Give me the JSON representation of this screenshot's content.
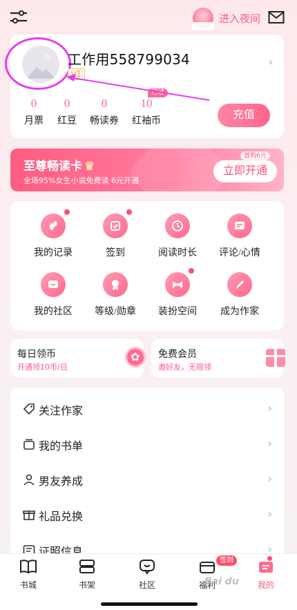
{
  "topbar": {
    "night_mode_label": "进入夜间"
  },
  "profile": {
    "username": "工作用558799034",
    "level": "v1",
    "stats": [
      {
        "value": "0",
        "label": "月票"
      },
      {
        "value": "0",
        "label": "红豆"
      },
      {
        "value": "0",
        "label": "畅读券"
      },
      {
        "value": "10",
        "label": "红袖币"
      }
    ],
    "expire_tag": "已过期",
    "recharge_label": "充值"
  },
  "vip": {
    "title": "至尊畅读卡",
    "subtitle": "全场95%女生小说免费读 6元开通",
    "first_buy_tag": "首购6元",
    "open_label": "立即开通"
  },
  "grid": [
    {
      "label": "我的记录",
      "icon": "footprint-icon",
      "dot": true
    },
    {
      "label": "签到",
      "icon": "checkin-icon",
      "dot": true
    },
    {
      "label": "阅读时长",
      "icon": "clock-icon",
      "dot": false
    },
    {
      "label": "评论/心情",
      "icon": "comment-icon",
      "dot": false
    },
    {
      "label": "我的社区",
      "icon": "community-icon",
      "dot": false
    },
    {
      "label": "等级/勋章",
      "icon": "medal-icon",
      "dot": false
    },
    {
      "label": "装扮空间",
      "icon": "bow-icon",
      "dot": true
    },
    {
      "label": "成为作家",
      "icon": "pen-icon",
      "dot": false
    }
  ],
  "daily_coin": {
    "title": "每日领币",
    "subtitle": "开通领10币/日"
  },
  "free_member": {
    "title": "免费会员",
    "subtitle": "邀好友，无限领"
  },
  "menu": [
    {
      "label": "关注作家",
      "icon": "tag-icon"
    },
    {
      "label": "我的书单",
      "icon": "booklist-icon"
    },
    {
      "label": "男友养成",
      "icon": "person-icon"
    },
    {
      "label": "礼品兑换",
      "icon": "gift-icon"
    },
    {
      "label": "证照信息",
      "icon": "id-card-icon"
    }
  ],
  "tabs": [
    {
      "label": "书城",
      "icon": "book-icon"
    },
    {
      "label": "书架",
      "icon": "shelf-icon"
    },
    {
      "label": "社区",
      "icon": "chat-icon"
    },
    {
      "label": "福利",
      "icon": "welfare-icon",
      "badge": "签到"
    },
    {
      "label": "我的",
      "icon": "mine-icon",
      "active": true
    }
  ],
  "colors": {
    "accent": "#ff5a82",
    "annotation": "#e63df0"
  },
  "watermark": "Bai du"
}
